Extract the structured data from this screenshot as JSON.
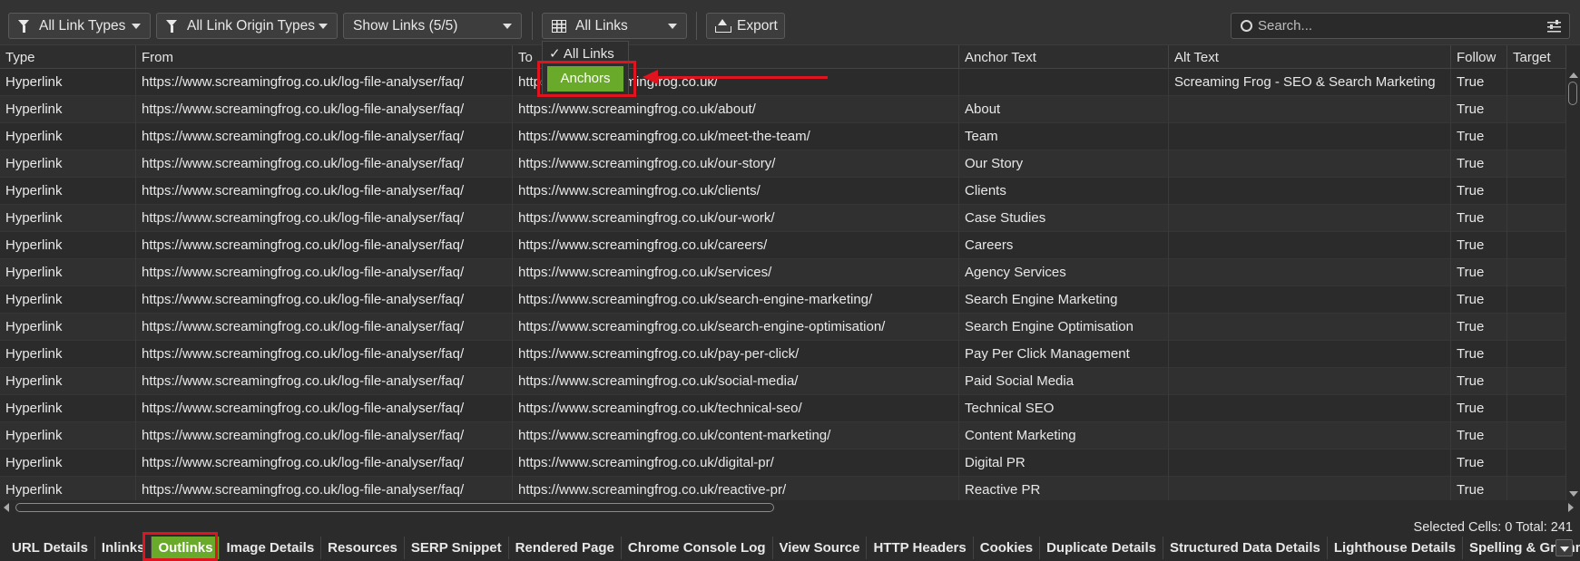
{
  "toolbar": {
    "link_types": "All Link Types",
    "origin_types": "All Link Origin Types",
    "show_links": "Show Links (5/5)",
    "view": "All Links",
    "export": "Export",
    "search_placeholder": "Search..."
  },
  "menu": {
    "all_links": "✓ All Links",
    "anchors": "Anchors"
  },
  "columns": [
    "Type",
    "From",
    "To",
    "Anchor Text",
    "Alt Text",
    "Follow",
    "Target"
  ],
  "rows": [
    [
      "Hyperlink",
      "https://www.screamingfrog.co.uk/log-file-analyser/faq/",
      "https://www.screamingfrog.co.uk/",
      "",
      "Screaming Frog - SEO & Search Marketing",
      "True",
      ""
    ],
    [
      "Hyperlink",
      "https://www.screamingfrog.co.uk/log-file-analyser/faq/",
      "https://www.screamingfrog.co.uk/about/",
      "About",
      "",
      "True",
      ""
    ],
    [
      "Hyperlink",
      "https://www.screamingfrog.co.uk/log-file-analyser/faq/",
      "https://www.screamingfrog.co.uk/meet-the-team/",
      "Team",
      "",
      "True",
      ""
    ],
    [
      "Hyperlink",
      "https://www.screamingfrog.co.uk/log-file-analyser/faq/",
      "https://www.screamingfrog.co.uk/our-story/",
      "Our Story",
      "",
      "True",
      ""
    ],
    [
      "Hyperlink",
      "https://www.screamingfrog.co.uk/log-file-analyser/faq/",
      "https://www.screamingfrog.co.uk/clients/",
      "Clients",
      "",
      "True",
      ""
    ],
    [
      "Hyperlink",
      "https://www.screamingfrog.co.uk/log-file-analyser/faq/",
      "https://www.screamingfrog.co.uk/our-work/",
      "Case Studies",
      "",
      "True",
      ""
    ],
    [
      "Hyperlink",
      "https://www.screamingfrog.co.uk/log-file-analyser/faq/",
      "https://www.screamingfrog.co.uk/careers/",
      "Careers",
      "",
      "True",
      ""
    ],
    [
      "Hyperlink",
      "https://www.screamingfrog.co.uk/log-file-analyser/faq/",
      "https://www.screamingfrog.co.uk/services/",
      "Agency Services",
      "",
      "True",
      ""
    ],
    [
      "Hyperlink",
      "https://www.screamingfrog.co.uk/log-file-analyser/faq/",
      "https://www.screamingfrog.co.uk/search-engine-marketing/",
      "Search Engine Marketing",
      "",
      "True",
      ""
    ],
    [
      "Hyperlink",
      "https://www.screamingfrog.co.uk/log-file-analyser/faq/",
      "https://www.screamingfrog.co.uk/search-engine-optimisation/",
      "Search Engine Optimisation",
      "",
      "True",
      ""
    ],
    [
      "Hyperlink",
      "https://www.screamingfrog.co.uk/log-file-analyser/faq/",
      "https://www.screamingfrog.co.uk/pay-per-click/",
      "Pay Per Click Management",
      "",
      "True",
      ""
    ],
    [
      "Hyperlink",
      "https://www.screamingfrog.co.uk/log-file-analyser/faq/",
      "https://www.screamingfrog.co.uk/social-media/",
      "Paid Social Media",
      "",
      "True",
      ""
    ],
    [
      "Hyperlink",
      "https://www.screamingfrog.co.uk/log-file-analyser/faq/",
      "https://www.screamingfrog.co.uk/technical-seo/",
      "Technical SEO",
      "",
      "True",
      ""
    ],
    [
      "Hyperlink",
      "https://www.screamingfrog.co.uk/log-file-analyser/faq/",
      "https://www.screamingfrog.co.uk/content-marketing/",
      "Content Marketing",
      "",
      "True",
      ""
    ],
    [
      "Hyperlink",
      "https://www.screamingfrog.co.uk/log-file-analyser/faq/",
      "https://www.screamingfrog.co.uk/digital-pr/",
      "Digital PR",
      "",
      "True",
      ""
    ],
    [
      "Hyperlink",
      "https://www.screamingfrog.co.uk/log-file-analyser/faq/",
      "https://www.screamingfrog.co.uk/reactive-pr/",
      "Reactive PR",
      "",
      "True",
      ""
    ]
  ],
  "status": {
    "text": "Selected Cells: 0  Total: 241"
  },
  "tabs": [
    {
      "label": "URL Details",
      "active": false
    },
    {
      "label": "Inlinks",
      "active": false
    },
    {
      "label": "Outlinks",
      "active": true
    },
    {
      "label": "Image Details",
      "active": false
    },
    {
      "label": "Resources",
      "active": false
    },
    {
      "label": "SERP Snippet",
      "active": false
    },
    {
      "label": "Rendered Page",
      "active": false
    },
    {
      "label": "Chrome Console Log",
      "active": false
    },
    {
      "label": "View Source",
      "active": false
    },
    {
      "label": "HTTP Headers",
      "active": false
    },
    {
      "label": "Cookies",
      "active": false
    },
    {
      "label": "Duplicate Details",
      "active": false
    },
    {
      "label": "Structured Data Details",
      "active": false
    },
    {
      "label": "Lighthouse Details",
      "active": false
    },
    {
      "label": "Spelling & Grammar De",
      "active": false
    }
  ],
  "colors": {
    "accent": "#6aaa2a",
    "annotation": "#e0141e",
    "background": "#2b2b2b"
  }
}
